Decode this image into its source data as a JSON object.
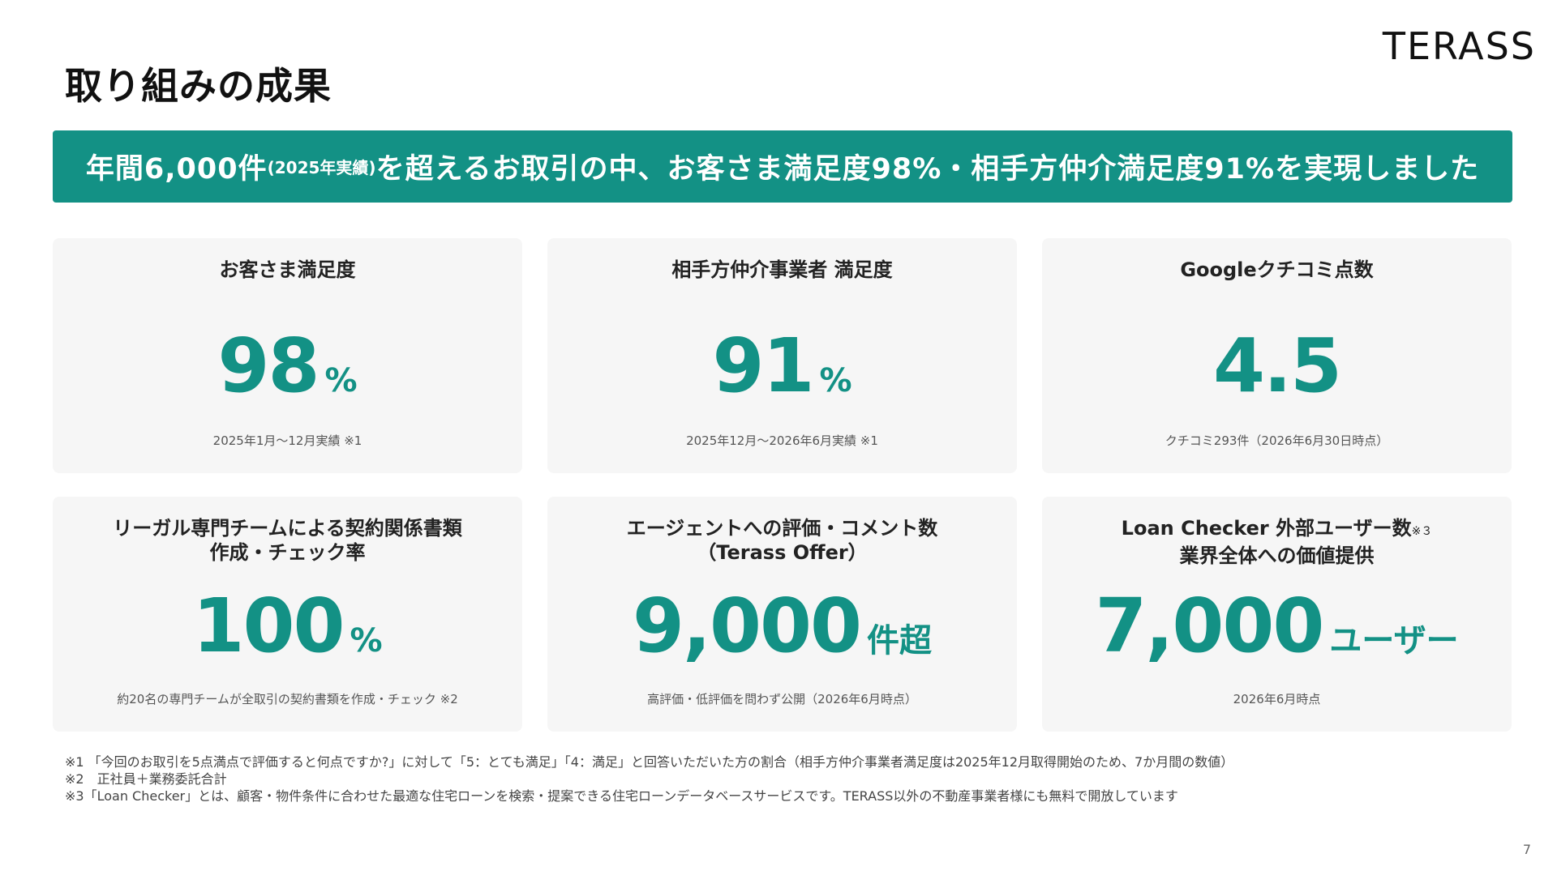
{
  "logo": "TERASS",
  "title": "取り組みの成果",
  "banner": {
    "part1": "年間6,000件",
    "part_small": "(2025年実績)",
    "part2": "を超えるお取引の中、お客さま満足度98%・相手方仲介満足度91%を実現しました"
  },
  "cards": [
    {
      "title": "お客さま満足度",
      "value": "98",
      "unit": "%",
      "note": "2025年1月〜12月実績 ※1"
    },
    {
      "title": "相手方仲介事業者 満足度",
      "value": "91",
      "unit": "%",
      "note": "2025年12月〜2026年6月実績 ※1"
    },
    {
      "title": "Googleクチコミ点数",
      "value": "4.5",
      "unit": "",
      "note": "クチコミ293件（2026年6月30日時点）"
    },
    {
      "title_line1": "リーガル専門チームによる契約関係書類",
      "title_line2": "作成・チェック率",
      "value": "100",
      "unit": "%",
      "note": "約20名の専門チームが全取引の契約書類を作成・チェック ※2"
    },
    {
      "title_line1": "エージェントへの評価・コメント数",
      "title_line2": "（Terass Offer）",
      "value": "9,000",
      "unit": "件超",
      "note": "高評価・低評価を問わず公開（2026年6月時点）"
    },
    {
      "title_line1": "Loan Checker 外部ユーザー数",
      "title_sup": "※３",
      "title_line2": "業界全体への価値提供",
      "value": "7,000",
      "unit": "ユーザー",
      "note": "2026年6月時点"
    }
  ],
  "footnotes": [
    "※1 「今回のお取引を5点満点で評価すると何点ですか?」に対して「5：とても満足」「4：満足」と回答いただいた方の割合（相手方仲介事業者満足度は2025年12月取得開始のため、7か月間の数値）",
    "※2　正社員＋業務委託合計",
    "※3「Loan Checker」とは、顧客・物件条件に合わせた最適な住宅ローンを検索・提案できる住宅ローンデータベースサービスです。TERASS以外の不動産事業者様にも無料で開放しています"
  ],
  "page_number": "7",
  "colors": {
    "accent": "#139185",
    "card_bg": "#f6f6f6"
  }
}
